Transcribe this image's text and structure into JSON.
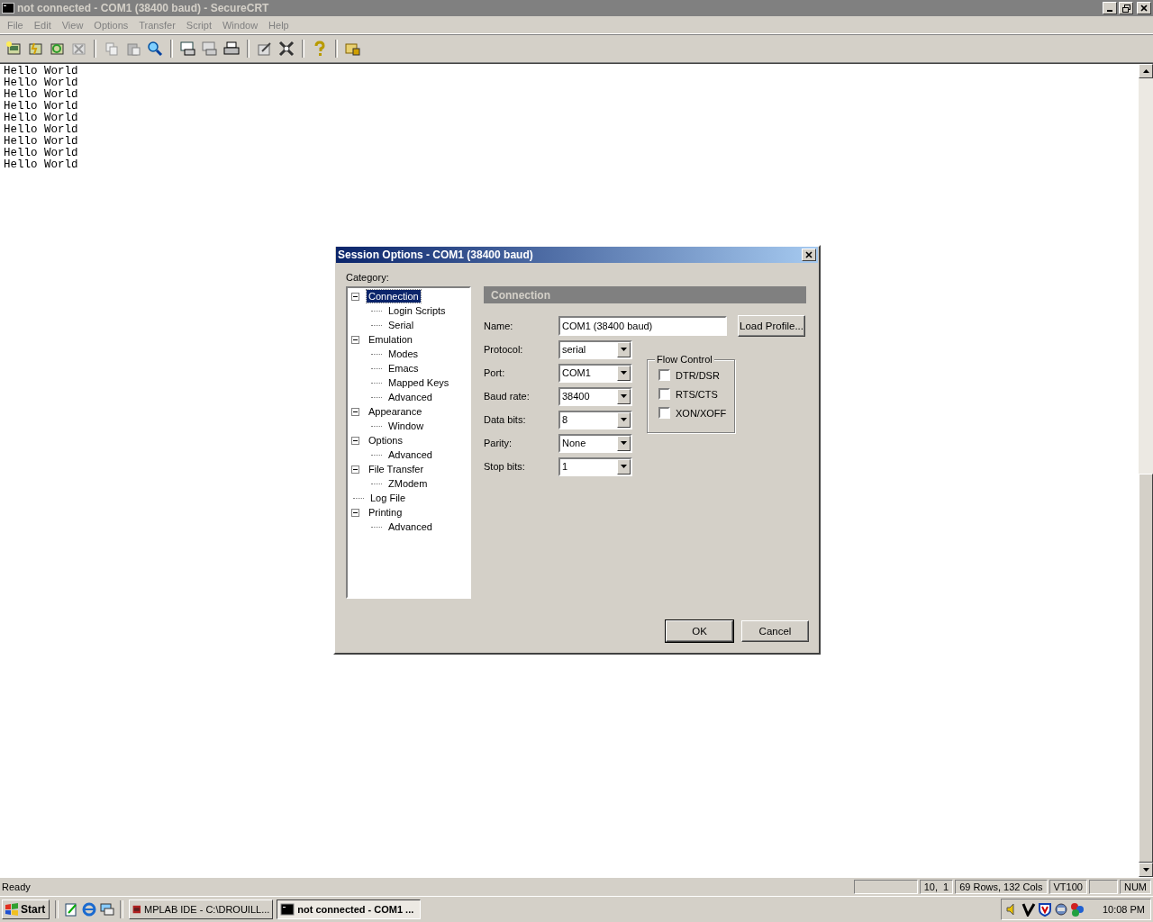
{
  "window": {
    "title": "not connected - COM1 (38400 baud) - SecureCRT"
  },
  "menu": [
    "File",
    "Edit",
    "View",
    "Options",
    "Transfer",
    "Script",
    "Window",
    "Help"
  ],
  "terminal": {
    "lines": [
      "Hello World",
      "Hello World",
      "Hello World",
      "Hello World",
      "Hello World",
      "Hello World",
      "Hello World",
      "Hello World",
      "Hello World"
    ]
  },
  "dialog": {
    "title": "Session Options - COM1 (38400 baud)",
    "category_label": "Category:",
    "tree": [
      {
        "label": "Connection",
        "selected": true,
        "expanded": true,
        "children": [
          {
            "label": "Login Scripts",
            "selected": false
          },
          {
            "label": "Serial",
            "selected": false
          }
        ]
      },
      {
        "label": "Emulation",
        "selected": false,
        "expanded": true,
        "children": [
          {
            "label": "Modes",
            "selected": false
          },
          {
            "label": "Emacs",
            "selected": false
          },
          {
            "label": "Mapped Keys",
            "selected": false
          },
          {
            "label": "Advanced",
            "selected": false
          }
        ]
      },
      {
        "label": "Appearance",
        "selected": false,
        "expanded": true,
        "children": [
          {
            "label": "Window",
            "selected": false
          }
        ]
      },
      {
        "label": "Options",
        "selected": false,
        "expanded": true,
        "children": [
          {
            "label": "Advanced",
            "selected": false
          }
        ]
      },
      {
        "label": "File Transfer",
        "selected": false,
        "expanded": true,
        "children": [
          {
            "label": "ZModem",
            "selected": false
          }
        ]
      },
      {
        "label": "Log File",
        "selected": false
      },
      {
        "label": "Printing",
        "selected": false,
        "expanded": true,
        "children": [
          {
            "label": "Advanced",
            "selected": false
          }
        ]
      }
    ],
    "panel_title": "Connection",
    "name": {
      "label": "Name:",
      "value": "COM1 (38400 baud)"
    },
    "load_profile": "Load Profile...",
    "fields": [
      {
        "label": "Protocol:",
        "value": "serial"
      },
      {
        "label": "Port:",
        "value": "COM1"
      },
      {
        "label": "Baud rate:",
        "value": "38400"
      },
      {
        "label": "Data bits:",
        "value": "8"
      },
      {
        "label": "Parity:",
        "value": "None"
      },
      {
        "label": "Stop bits:",
        "value": "1"
      }
    ],
    "flow_control": {
      "title": "Flow Control",
      "options": [
        {
          "label": "DTR/DSR",
          "checked": false
        },
        {
          "label": "RTS/CTS",
          "checked": false
        },
        {
          "label": "XON/XOFF",
          "checked": false
        }
      ]
    },
    "buttons": [
      "OK",
      "Cancel"
    ]
  },
  "status_bar": {
    "text": "Ready",
    "panes": [
      "10,  1",
      "69 Rows, 132 Cols",
      "VT100",
      "NUM"
    ]
  },
  "taskbar": {
    "start": "Start",
    "tasks": [
      {
        "label": "MPLAB IDE - C:\\DROUILL...",
        "selected": false
      },
      {
        "label": "not connected - COM1 ...",
        "selected": true
      }
    ],
    "clock": "10:08 PM"
  }
}
